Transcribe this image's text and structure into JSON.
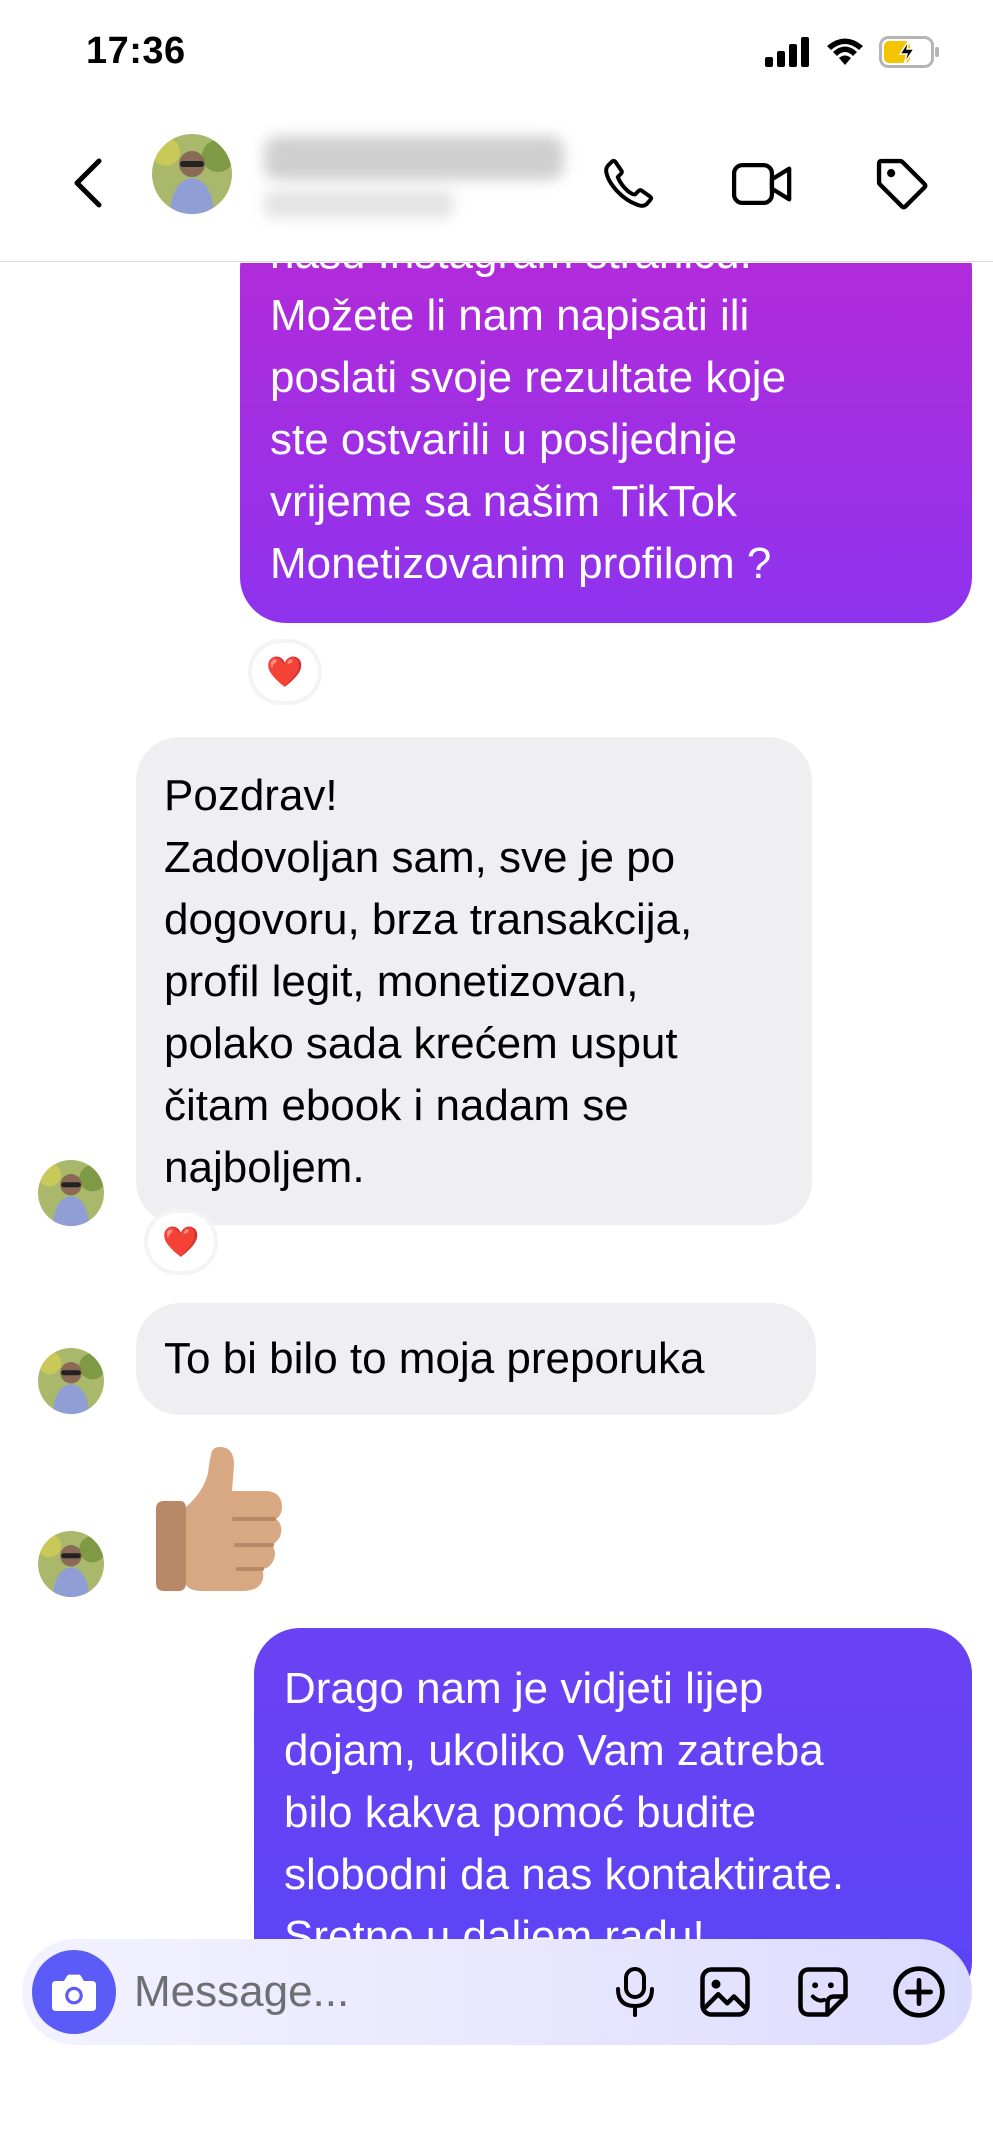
{
  "status": {
    "time": "17:36"
  },
  "header": {
    "contact_name": "████████ ████",
    "contact_subtitle": "█████ ███"
  },
  "messages": [
    {
      "direction": "outgoing",
      "text": "našu Instagram stranicu.\nMožete li nam napisati ili\nposlati svoje rezultate koje\nste ostvarili u posljednje\nvrijeme sa našim TikTok\nMonetizovanim profilom ?",
      "reaction": "❤️"
    },
    {
      "direction": "incoming",
      "text": "Pozdrav!\nZadovoljan sam, sve je po\ndogovoru, brza transakcija,\nprofil legit, monetizovan,\npolako sada krećem usput\nčitam ebook i nadam se\nnajboljem.",
      "reaction": "❤️"
    },
    {
      "direction": "incoming",
      "text": "To bi bilo to moja preporuka"
    },
    {
      "direction": "incoming",
      "emoji": "thumbs-up"
    },
    {
      "direction": "outgoing",
      "text": "Drago nam je vidjeti lijep\ndojam, ukoliko Vam zatreba\nbilo kakva pomoć budite\nslobodni da nas kontaktirate.\nSretno u daljem radu!"
    }
  ],
  "composer": {
    "placeholder": "Message..."
  },
  "colors": {
    "outgoing_top": "#b42ad8",
    "outgoing_bottom": "#5a44f6",
    "incoming_bg": "#efeff1",
    "accent": "#5b5bf7"
  },
  "icons": [
    "back-chevron-icon",
    "phone-icon",
    "video-icon",
    "tag-icon",
    "camera-icon",
    "microphone-icon",
    "gallery-icon",
    "sticker-icon",
    "plus-icon"
  ]
}
